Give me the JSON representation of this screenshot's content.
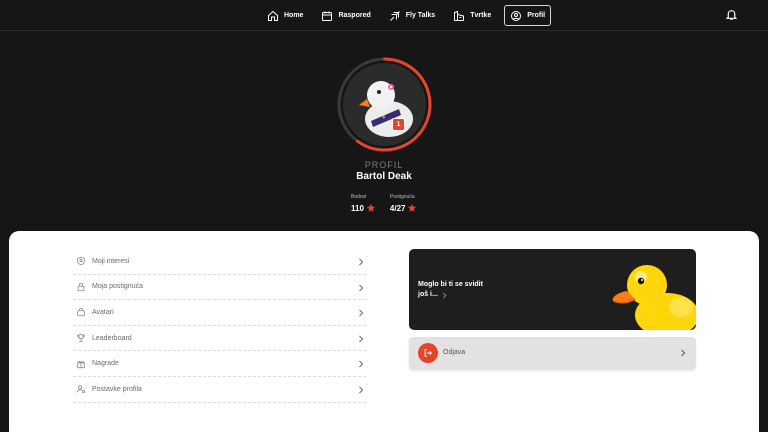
{
  "nav": {
    "items": [
      {
        "label": "Home",
        "icon": "home-icon"
      },
      {
        "label": "Raspored",
        "icon": "calendar-icon"
      },
      {
        "label": "Fly Talks",
        "icon": "plane-icon"
      },
      {
        "label": "Tvrtke",
        "icon": "company-icon"
      },
      {
        "label": "Profil",
        "icon": "user-circle-icon",
        "active": true
      }
    ],
    "notifications_icon": "bell-icon"
  },
  "profile": {
    "section_label": "PROFIL",
    "name": "Bartol Deak",
    "level": "1",
    "progress": 0.6,
    "stats": {
      "points_label": "Bodovi",
      "points_value": "110",
      "achievements_label": "Postignuća",
      "achievements_value": "4/27"
    }
  },
  "menu": {
    "items": [
      {
        "label": "Moji interesi",
        "icon": "shield-icon"
      },
      {
        "label": "Moja postignuća",
        "icon": "lock-icon"
      },
      {
        "label": "Avatari",
        "icon": "bag-icon"
      },
      {
        "label": "Leaderboard",
        "icon": "trophy-icon"
      },
      {
        "label": "Nagrade",
        "icon": "gift-icon"
      },
      {
        "label": "Postavke profila",
        "icon": "user-settings-icon"
      }
    ]
  },
  "promo": {
    "text_line1": "Moglo bi ti se svidit",
    "text_line2": "još i..."
  },
  "logout": {
    "label": "Odjava"
  },
  "colors": {
    "accent": "#e3452f",
    "background": "#161616",
    "panel": "#ffffff",
    "duck_yellow": "#ffd60a"
  }
}
